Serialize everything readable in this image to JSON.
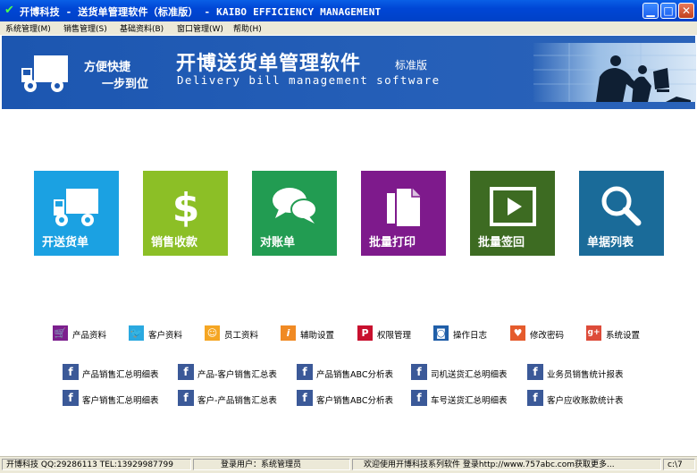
{
  "window": {
    "title": "开博科技 - 送货单管理软件（标准版） - KAIBO EFFICIENCY MANAGEMENT"
  },
  "menu": [
    "系统管理(M)",
    "销售管理(S)",
    "基础资料(B)",
    "窗口管理(W)",
    "帮助(H)"
  ],
  "banner": {
    "slogan1": "方便快捷",
    "slogan2": "一步到位",
    "title_cn": "开博送货单管理软件",
    "edition": "标准版",
    "title_en": "Delivery bill management software"
  },
  "tiles": [
    {
      "label": "开送货单",
      "icon": "truck-icon",
      "color": "#1ba1e2"
    },
    {
      "label": "销售收款",
      "icon": "dollar-icon",
      "color": "#8cbf26"
    },
    {
      "label": "对账单",
      "icon": "chat-bubbles-icon",
      "color": "#229c52"
    },
    {
      "label": "批量打印",
      "icon": "documents-icon",
      "color": "#7e1a8c"
    },
    {
      "label": "批量签回",
      "icon": "play-icon",
      "color": "#3d6b22"
    },
    {
      "label": "单据列表",
      "icon": "search-icon",
      "color": "#1a6b99"
    }
  ],
  "quicklinks": [
    {
      "label": "产品资料",
      "icon": "cart-icon",
      "color": "#7c1f8e"
    },
    {
      "label": "客户资料",
      "icon": "twitter-icon",
      "color": "#2aa9e0"
    },
    {
      "label": "员工资料",
      "icon": "users-icon",
      "color": "#f5a623"
    },
    {
      "label": "辅助设置",
      "icon": "info-icon",
      "color": "#f08a24"
    },
    {
      "label": "权限管理",
      "icon": "pinterest-icon",
      "color": "#c8102e"
    },
    {
      "label": "操作日志",
      "icon": "camera-icon",
      "color": "#1f5ea8"
    },
    {
      "label": "修改密码",
      "icon": "heart-icon",
      "color": "#e55b2c"
    },
    {
      "label": "系统设置",
      "icon": "google-plus-icon",
      "color": "#dd4b39"
    }
  ],
  "reports": [
    [
      "产品销售汇总明细表",
      "产品-客户销售汇总表",
      "产品销售ABC分析表",
      "司机送货汇总明细表",
      "业务员销售统计报表"
    ],
    [
      "客户销售汇总明细表",
      "客户-产品销售汇总表",
      "客户销售ABC分析表",
      "车号送货汇总明细表",
      "客户应收账款统计表"
    ]
  ],
  "status": {
    "company": "开博科技  QQ:29286113 TEL:13929987799",
    "user": "登录用户：系统管理员",
    "welcome": "欢迎使用开博科技系列软件   登录http://www.757abc.com获取更多...",
    "path": "c:\\7"
  }
}
